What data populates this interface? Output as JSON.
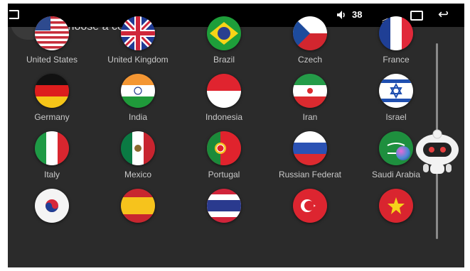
{
  "statusbar": {
    "volume_level": "38",
    "icons": [
      "home-icon",
      "volume-icon",
      "arrows-up-icon",
      "window-icon",
      "back-icon"
    ]
  },
  "header": {
    "title": "Choose a country"
  },
  "countries": [
    {
      "label": "United States",
      "flag": "us"
    },
    {
      "label": "United Kingdom",
      "flag": "uk"
    },
    {
      "label": "Brazil",
      "flag": "br"
    },
    {
      "label": "Czech",
      "flag": "cz"
    },
    {
      "label": "France",
      "flag": "fr"
    },
    {
      "label": "Germany",
      "flag": "de"
    },
    {
      "label": "India",
      "flag": "in"
    },
    {
      "label": "Indonesia",
      "flag": "id"
    },
    {
      "label": "Iran",
      "flag": "ir"
    },
    {
      "label": "Israel",
      "flag": "il"
    },
    {
      "label": "Italy",
      "flag": "it"
    },
    {
      "label": "Mexico",
      "flag": "mx"
    },
    {
      "label": "Portugal",
      "flag": "pt"
    },
    {
      "label": "Russian Federat",
      "flag": "ru"
    },
    {
      "label": "Saudi Arabia",
      "flag": "sa"
    },
    {
      "label": "",
      "flag": "kr"
    },
    {
      "label": "",
      "flag": "es"
    },
    {
      "label": "",
      "flag": "th"
    },
    {
      "label": "",
      "flag": "tr"
    },
    {
      "label": "",
      "flag": "vn"
    }
  ],
  "colors": {
    "background": "#2b2b2b",
    "statusbar": "#000000",
    "label": "#c9c9c9"
  }
}
